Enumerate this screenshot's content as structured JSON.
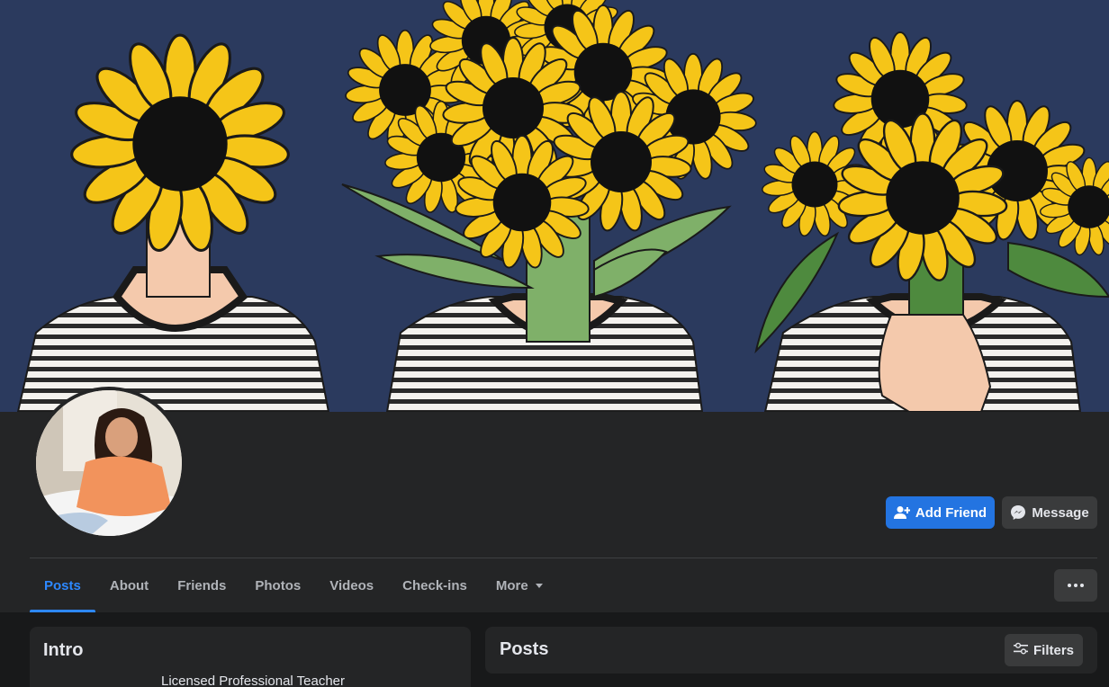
{
  "profile": {
    "add_friend_label": "Add Friend",
    "message_label": "Message"
  },
  "tabs": [
    {
      "label": "Posts",
      "active": true
    },
    {
      "label": "About"
    },
    {
      "label": "Friends"
    },
    {
      "label": "Photos"
    },
    {
      "label": "Videos"
    },
    {
      "label": "Check-ins"
    },
    {
      "label": "More"
    }
  ],
  "intro": {
    "title": "Intro",
    "bio": "Licensed Professional Teacher"
  },
  "posts": {
    "title": "Posts",
    "filters_label": "Filters"
  },
  "icons": {
    "add_friend": "person-plus-icon",
    "message": "messenger-icon",
    "more": "chevron-down-icon",
    "options": "ellipsis-icon",
    "filters": "sliders-icon"
  },
  "colors": {
    "accent": "#2d88ff",
    "primary_button": "#2374e1",
    "surface": "#242526",
    "background": "#18191a",
    "cover_bg": "#2b3a5e",
    "sunflower_petal": "#f5c518"
  }
}
